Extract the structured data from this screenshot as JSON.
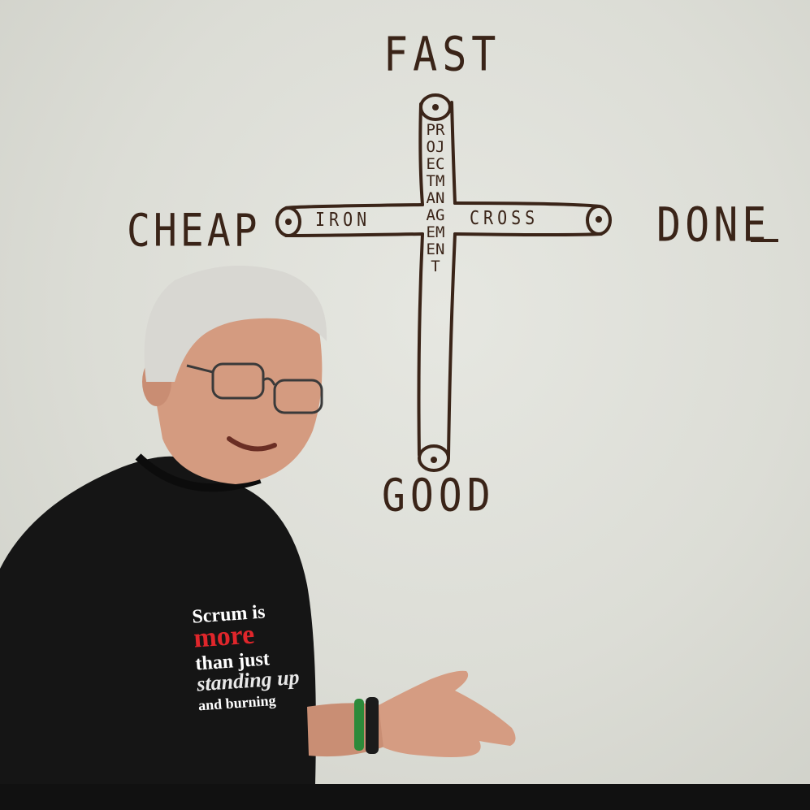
{
  "whiteboard": {
    "top_label": "FAST",
    "left_label": "CHEAP",
    "right_label": "DONE",
    "bottom_label": "GOOD",
    "bar_left_text": "IRON",
    "bar_right_text": "CROSS",
    "vertical_bar_text": "PROJECTMANAGEMENT"
  },
  "shirt": {
    "line1": "Scrum is",
    "line2": "more",
    "line3": "than just",
    "line4": "standing up",
    "line5": "and burning"
  },
  "colors": {
    "marker": "#3a2418",
    "whiteboard": "#dfe0da",
    "shirt": "#151515",
    "accent_red": "#e0262b"
  }
}
